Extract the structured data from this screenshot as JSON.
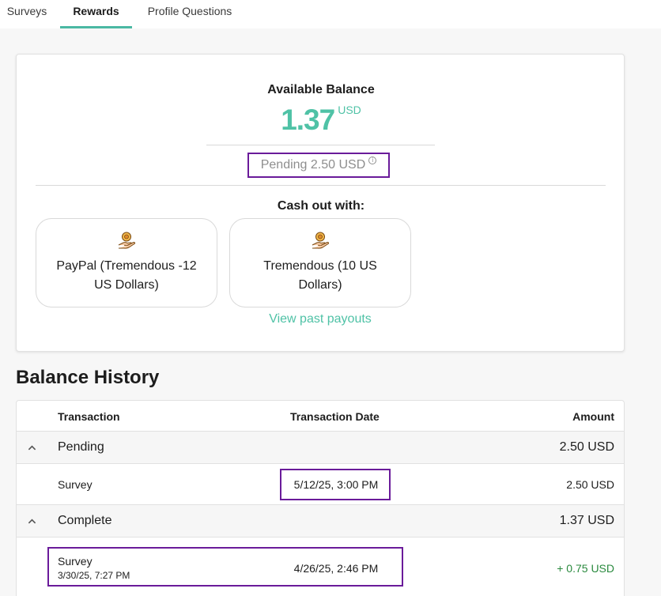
{
  "tabs": [
    {
      "label": "Surveys"
    },
    {
      "label": "Rewards",
      "active": true
    },
    {
      "label": "Profile Questions"
    }
  ],
  "balance": {
    "title": "Available Balance",
    "amount": "1.37",
    "currency": "USD",
    "pending": "Pending 2.50 USD"
  },
  "cashout": {
    "title": "Cash out with:",
    "options": [
      {
        "label": "PayPal (Tremendous -12 US Dollars)",
        "icon": "coin-hand-icon"
      },
      {
        "label": "Tremendous (10 US Dollars)",
        "icon": "coin-hand-icon"
      }
    ],
    "past_payouts_link": "View past payouts"
  },
  "history": {
    "title": "Balance History",
    "columns": [
      "Transaction",
      "Transaction Date",
      "Amount"
    ],
    "groups": [
      {
        "label": "Pending",
        "total": "2.50 USD",
        "rows": [
          {
            "type": "Survey",
            "subdate": "",
            "date": "5/12/25, 3:00 PM",
            "amount": "2.50 USD"
          }
        ]
      },
      {
        "label": "Complete",
        "total": "1.37 USD",
        "rows": [
          {
            "type": "Survey",
            "subdate": "3/30/25, 7:27 PM",
            "date": "4/26/25, 2:46 PM",
            "amount": "+ 0.75 USD"
          }
        ]
      }
    ]
  },
  "colors": {
    "accent": "#4fc2a6",
    "highlight": "#6a1b9a",
    "positive": "#2a8a3e"
  }
}
